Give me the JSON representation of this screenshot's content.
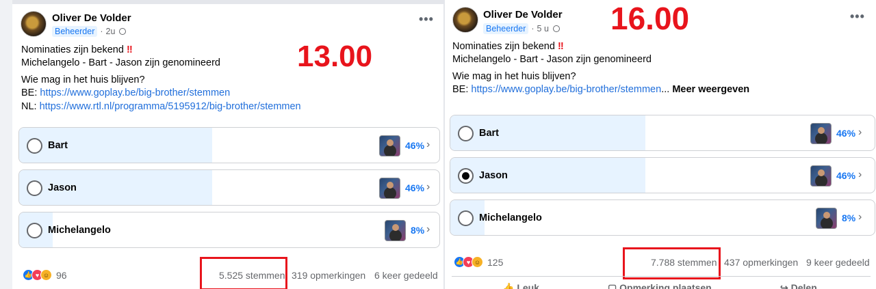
{
  "posts": [
    {
      "author": "Oliver De Volder",
      "role": "Beheerder",
      "age": "2u",
      "stamp_time": "13.00",
      "text": {
        "line1": "Nominaties zijn bekend",
        "line2": "Michelangelo - Bart - Jason  zijn genomineerd",
        "question": "Wie mag in het huis blijven?",
        "be_prefix": "BE:",
        "be_link": "https://www.goplay.be/big-brother/stemmen",
        "nl_prefix": "NL:",
        "nl_link": "https://www.rtl.nl/programma/5195912/big-brother/stemmen"
      },
      "options": [
        {
          "label": "Bart",
          "percent_text": "46%",
          "share": 0.46,
          "selected": false
        },
        {
          "label": "Jason",
          "percent_text": "46%",
          "share": 0.46,
          "selected": false
        },
        {
          "label": "Michelangelo",
          "percent_text": "8%",
          "share": 0.08,
          "selected": false
        }
      ],
      "reactions_count": "96",
      "votes": "5.525 stemmen",
      "comments": "319 opmerkingen",
      "shares": "6 keer gedeeld"
    },
    {
      "author": "Oliver De Volder",
      "role": "Beheerder",
      "age": "5 u",
      "stamp_time": "16.00",
      "text": {
        "line1": "Nominaties zijn bekend",
        "line2": "Michelangelo - Bart - Jason  zijn genomineerd",
        "question": "Wie mag in het huis blijven?",
        "be_prefix": "BE:",
        "be_link": "https://www.goplay.be/big-brother/stemmen",
        "see_more": "Meer weergeven"
      },
      "options": [
        {
          "label": "Bart",
          "percent_text": "46%",
          "share": 0.46,
          "selected": false
        },
        {
          "label": "Jason",
          "percent_text": "46%",
          "share": 0.46,
          "selected": true
        },
        {
          "label": "Michelangelo",
          "percent_text": "8%",
          "share": 0.08,
          "selected": false
        }
      ],
      "reactions_count": "125",
      "votes": "7.788 stemmen",
      "comments": "437 opmerkingen",
      "shares": "9 keer gedeeld",
      "actions": [
        "Leuk",
        "Opmerking plaatsen",
        "Delen"
      ]
    }
  ],
  "colors": {
    "stamp": "#e8141c",
    "accent": "#1877f2",
    "poll_fill": "#e7f3ff"
  },
  "icons": [
    "more-options-icon",
    "globe-icon",
    "double-exclamation-icon",
    "like-reaction-icon",
    "love-reaction-icon",
    "haha-reaction-icon",
    "chevron-right-icon"
  ]
}
